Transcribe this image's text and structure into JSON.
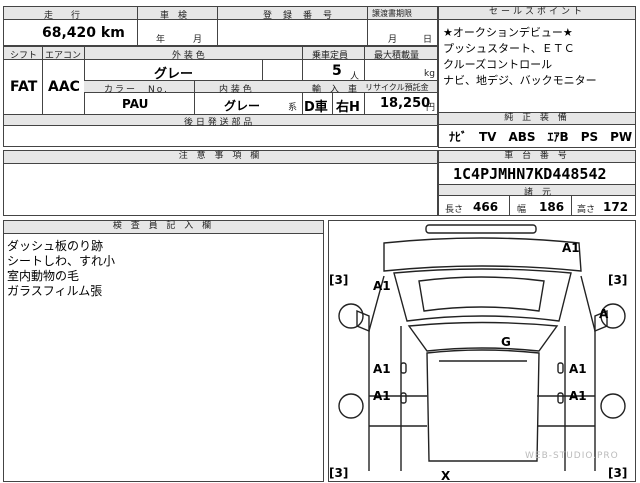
{
  "top_row": {
    "mileage_label": "走　　行",
    "mileage_value": "68,420",
    "mileage_unit": "km",
    "shaken_label": "車　検",
    "shaken_year": "年",
    "shaken_month": "月",
    "reg_label": "登　録　番　号",
    "transfer_label": "譲渡書期限",
    "transfer_month": "月",
    "transfer_day": "日"
  },
  "specs": {
    "shift_label": "シフト",
    "shift_value": "FAT",
    "ac_label": "エアコン",
    "ac_value": "AAC",
    "exterior_label": "外 装 色",
    "exterior_value": "グレー",
    "capacity_label": "乗車定員",
    "capacity_value": "5",
    "capacity_unit": "人",
    "load_label": "最大積載量",
    "load_unit": "kg",
    "color_no_label": "カラー　No.",
    "color_no_value": "PAU",
    "interior_label": "内 装 色",
    "interior_value": "グレー",
    "interior_suffix": "系",
    "import_label": "輸　入　車",
    "import_value": "D車",
    "handle_value": "右H",
    "recycle_label": "リサイクル預託金",
    "recycle_value": "18,250",
    "recycle_unit": "円",
    "later_docs_label": "後 日 発 送 部 品"
  },
  "sales_points": {
    "label": "セールスポイント",
    "lines": [
      "★オークションデビュー★",
      "プッシュスタート、ＥＴＣ",
      "クルーズコントロール",
      "ナビ、地デジ、バックモニター"
    ]
  },
  "equipment": {
    "label": "純 正 装 備",
    "value": "ﾅﾋﾞ　TV　ABS　ｴｱB　PS　PW"
  },
  "notes": {
    "label": "注 意 事 項 欄"
  },
  "chassis": {
    "label": "車 台 番 号",
    "value": "1C4PJMHN7KD448542",
    "dims_label": "諸　元",
    "length_label": "長さ",
    "length_value": "466",
    "width_label": "幅",
    "width_value": "186",
    "height_label": "高さ",
    "height_value": "172"
  },
  "inspector": {
    "label": "検 査 員 記 入 欄",
    "lines": [
      "ダッシュ板のり跡",
      "シートしわ、すれ小",
      "室内動物の毛",
      "ガラスフィルム張"
    ]
  },
  "diagram_marks": {
    "roof_a1": "A1",
    "fl_a1": "A1",
    "fr_a": "A",
    "front_g": "G",
    "l_door1": "A1",
    "r_door1": "A1",
    "l_door2": "A1",
    "r_door2": "A1",
    "tire_fl": "3",
    "tire_fr": "3",
    "tire_rl": "3",
    "tire_rr": "3",
    "rear_x": "X",
    "watermark": "WEB-STUDIO.PRO"
  }
}
